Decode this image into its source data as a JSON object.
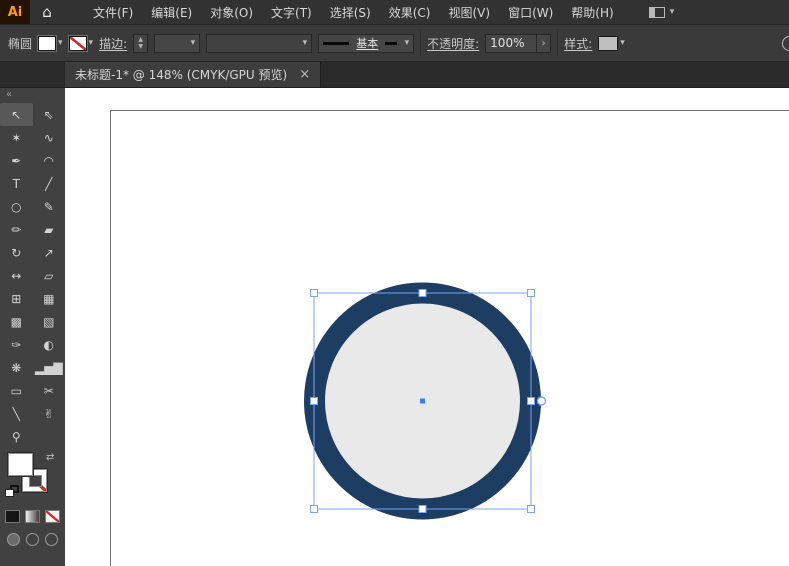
{
  "icons": {
    "dropdown": "▾",
    "stepper_up": "▲",
    "stepper_down": "▼",
    "close": "×",
    "home": "⌂",
    "collapse": "«",
    "swap": "⇄",
    "panel_arrow": "›"
  },
  "app": {
    "logo_text": "Ai",
    "accent_orange": "#ff9a23"
  },
  "menubar": {
    "items": [
      {
        "name": "menu-file",
        "label": "文件(F)"
      },
      {
        "name": "menu-edit",
        "label": "编辑(E)"
      },
      {
        "name": "menu-object",
        "label": "对象(O)"
      },
      {
        "name": "menu-type",
        "label": "文字(T)"
      },
      {
        "name": "menu-select",
        "label": "选择(S)"
      },
      {
        "name": "menu-effect",
        "label": "效果(C)"
      },
      {
        "name": "menu-view",
        "label": "视图(V)"
      },
      {
        "name": "menu-window",
        "label": "窗口(W)"
      },
      {
        "name": "menu-help",
        "label": "帮助(H)"
      }
    ]
  },
  "controlbar": {
    "context_label": "椭圆",
    "stroke_label": "描边:",
    "stroke_style": "基本",
    "opacity_label": "不透明度:",
    "opacity_value": "100%",
    "style_label": "样式:"
  },
  "tabbar": {
    "title": "未标题-1* @ 148% (CMYK/GPU 预览)"
  },
  "toolbar": {
    "tools": [
      {
        "name": "selection-tool",
        "glyph": "↖",
        "active": true
      },
      {
        "name": "direct-selection-tool",
        "glyph": "⇖"
      },
      {
        "name": "magic-wand-tool",
        "glyph": "✶"
      },
      {
        "name": "lasso-tool",
        "glyph": "∿"
      },
      {
        "name": "pen-tool",
        "glyph": "✒"
      },
      {
        "name": "curvature-tool",
        "glyph": "◠"
      },
      {
        "name": "type-tool",
        "glyph": "T"
      },
      {
        "name": "line-segment-tool",
        "glyph": "╱"
      },
      {
        "name": "ellipse-tool",
        "glyph": "○"
      },
      {
        "name": "paintbrush-tool",
        "glyph": "✎"
      },
      {
        "name": "pencil-tool",
        "glyph": "✏"
      },
      {
        "name": "eraser-tool",
        "glyph": "▰"
      },
      {
        "name": "rotate-tool",
        "glyph": "↻"
      },
      {
        "name": "scale-tool",
        "glyph": "↗"
      },
      {
        "name": "width-tool",
        "glyph": "↔"
      },
      {
        "name": "free-transform-tool",
        "glyph": "▱"
      },
      {
        "name": "shape-builder-tool",
        "glyph": "⊞"
      },
      {
        "name": "perspective-grid-tool",
        "glyph": "▦"
      },
      {
        "name": "mesh-tool",
        "glyph": "▩"
      },
      {
        "name": "gradient-tool",
        "glyph": "▧"
      },
      {
        "name": "eyedropper-tool",
        "glyph": "✑"
      },
      {
        "name": "blend-tool",
        "glyph": "◐"
      },
      {
        "name": "symbol-sprayer-tool",
        "glyph": "❋"
      },
      {
        "name": "column-graph-tool",
        "glyph": "▂▅▇"
      },
      {
        "name": "artboard-tool",
        "glyph": "▭"
      },
      {
        "name": "slice-tool",
        "glyph": "✂"
      },
      {
        "name": "knife-tool",
        "glyph": "╲"
      },
      {
        "name": "hand-tool",
        "glyph": "✌"
      },
      {
        "name": "zoom-tool",
        "glyph": "⚲"
      }
    ]
  },
  "canvas": {
    "circle": {
      "fill": "#e9e9ea",
      "stroke": "#1d3d63",
      "stroke_width": 21
    },
    "selection": {
      "color": "#7aa5f2",
      "center_dot_color": "#3a7bf6"
    }
  }
}
